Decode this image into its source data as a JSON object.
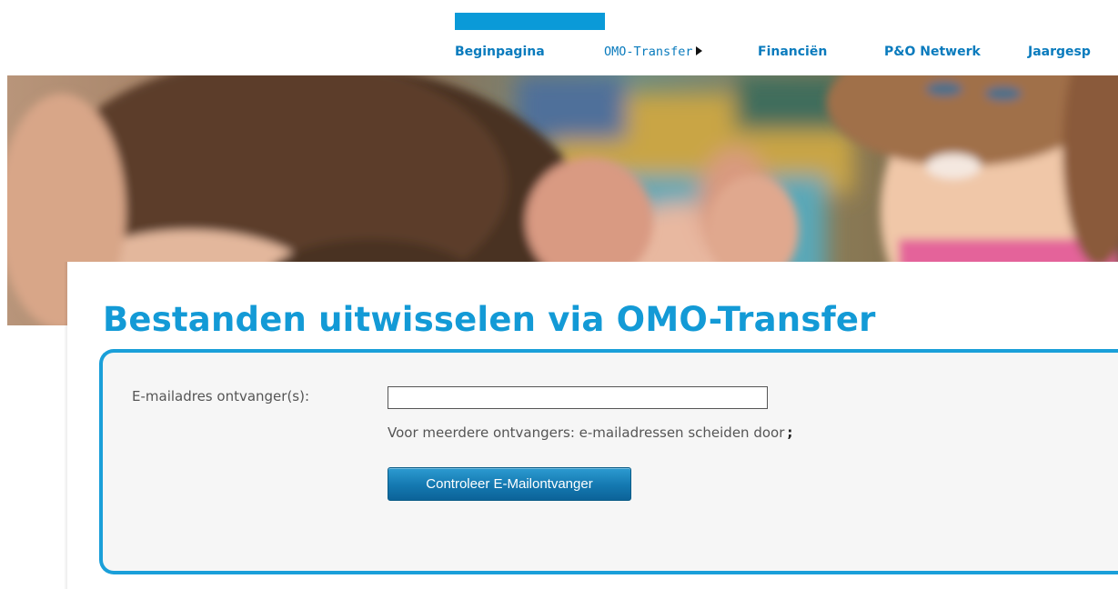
{
  "nav": {
    "items": [
      {
        "label": "Beginpagina",
        "active": true,
        "has_submenu": false
      },
      {
        "label": "OMO-Transfer",
        "active": false,
        "has_submenu": true
      },
      {
        "label": "Financiën",
        "active": false,
        "has_submenu": false
      },
      {
        "label": "P&O Netwerk",
        "active": false,
        "has_submenu": false
      },
      {
        "label": "Jaargesp",
        "active": false,
        "has_submenu": false
      }
    ],
    "accent_color": "#0a9ad8",
    "link_color": "#0a7bbd"
  },
  "main": {
    "title": "Bestanden uitwisselen via OMO-Transfer",
    "form": {
      "email_label": "E-mailadres ontvanger(s):",
      "email_value": "",
      "email_placeholder": "",
      "hint_text": "Voor meerdere ontvangers: e-mailadressen scheiden door",
      "hint_separator": ";",
      "check_button_label": "Controleer E-Mailontvanger"
    }
  },
  "colors": {
    "title": "#139ad6",
    "form_border": "#1a9fd9",
    "form_background": "#f6f6f6",
    "button": "#1478b0"
  },
  "icons": {
    "submenu_indicator": "triangle-right-icon"
  }
}
